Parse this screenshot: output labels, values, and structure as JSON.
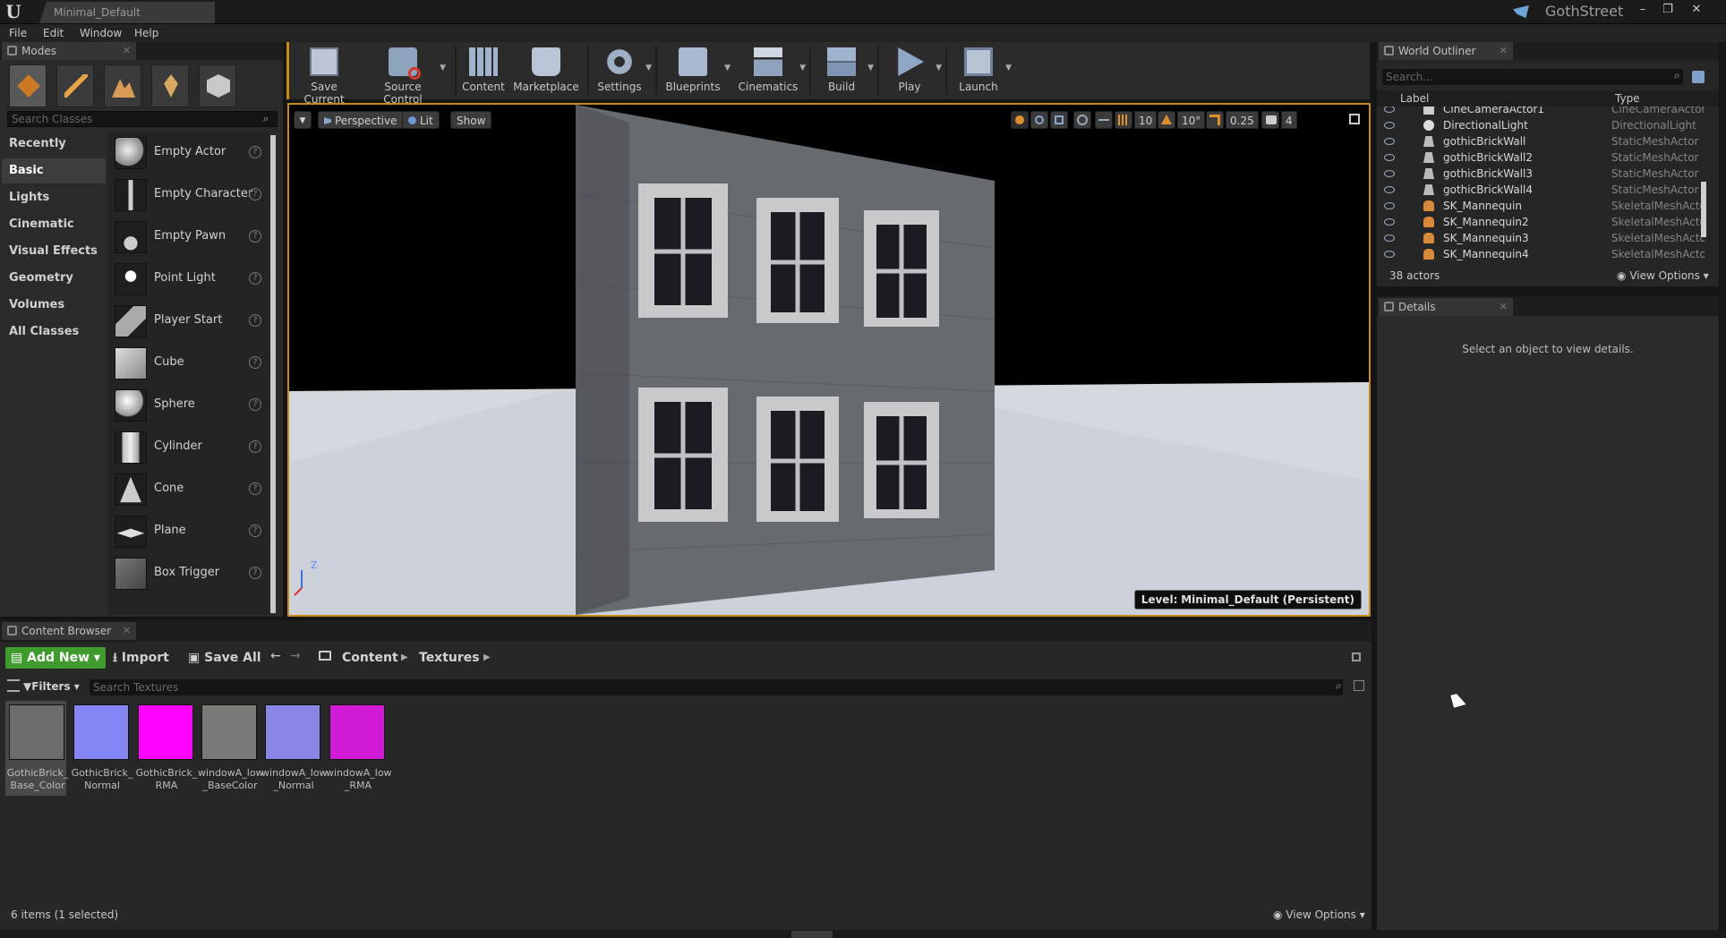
{
  "app": {
    "document_tab": "Minimal_Default",
    "project": "GothStreet"
  },
  "menu": [
    "File",
    "Edit",
    "Window",
    "Help"
  ],
  "modes": {
    "tab_label": "Modes",
    "search_placeholder": "Search Classes",
    "categories": [
      "Recently Placed",
      "Basic",
      "Lights",
      "Cinematic",
      "Visual Effects",
      "Geometry",
      "Volumes",
      "All Classes"
    ],
    "selected_category": "Basic",
    "items": [
      "Empty Actor",
      "Empty Character",
      "Empty Pawn",
      "Point Light",
      "Player Start",
      "Cube",
      "Sphere",
      "Cylinder",
      "Cone",
      "Plane",
      "Box Trigger"
    ]
  },
  "toolbar": {
    "save_current": "Save Current",
    "source_control": "Source Control",
    "content": "Content",
    "marketplace": "Marketplace",
    "settings": "Settings",
    "blueprints": "Blueprints",
    "cinematics": "Cinematics",
    "build": "Build",
    "play": "Play",
    "launch": "Launch"
  },
  "viewport": {
    "perspective": "Perspective",
    "lit": "Lit",
    "show": "Show",
    "grid_snap": "10",
    "rotation_snap": "10°",
    "scale_snap": "0.25",
    "camera_speed": "4",
    "level_label": "Level:",
    "level_name": "Minimal_Default (Persistent)",
    "axis_z": "Z"
  },
  "content_browser": {
    "tab_label": "Content Browser",
    "add_new": "Add New",
    "import": "Import",
    "save_all": "Save All",
    "path": [
      "Content",
      "Textures"
    ],
    "filters": "Filters",
    "search_placeholder": "Search Textures",
    "assets": [
      {
        "name": "GothicBrick_ Base_Color",
        "color": "#6c6c6a"
      },
      {
        "name": "GothicBrick_ Normal",
        "color": "#8484f4"
      },
      {
        "name": "GothicBrick_ RMA",
        "color": "#ff00ff"
      },
      {
        "name": "windowA_low _BaseColor",
        "color": "#7a7a76"
      },
      {
        "name": "windowA_low _Normal",
        "color": "#8a86e6"
      },
      {
        "name": "windowA_low _RMA",
        "color": "#d01ad6"
      }
    ],
    "status": "6 items (1 selected)",
    "view_options": "View Options"
  },
  "outliner": {
    "tab_label": "World Outliner",
    "search_placeholder": "Search...",
    "col_label": "Label",
    "col_type": "Type",
    "rows": [
      {
        "label": "CineCameraActor1",
        "type": "CineCameraActor"
      },
      {
        "label": "DirectionalLight",
        "type": "DirectionalLight"
      },
      {
        "label": "gothicBrickWall",
        "type": "StaticMeshActor"
      },
      {
        "label": "gothicBrickWall2",
        "type": "StaticMeshActor"
      },
      {
        "label": "gothicBrickWall3",
        "type": "StaticMeshActor"
      },
      {
        "label": "gothicBrickWall4",
        "type": "StaticMeshActor"
      },
      {
        "label": "SK_Mannequin",
        "type": "SkeletalMeshActo"
      },
      {
        "label": "SK_Mannequin2",
        "type": "SkeletalMeshActo"
      },
      {
        "label": "SK_Mannequin3",
        "type": "SkeletalMeshActo"
      },
      {
        "label": "SK_Mannequin4",
        "type": "SkeletalMeshActo"
      }
    ],
    "actor_count": "38 actors",
    "view_options": "View Options"
  },
  "details": {
    "tab_label": "Details",
    "empty_message": "Select an object to view details."
  },
  "colors": {
    "accent": "#c88b18",
    "add_new": "#3f9b2d",
    "panel": "#2a2a2a",
    "selection_highlight": "#494949"
  }
}
